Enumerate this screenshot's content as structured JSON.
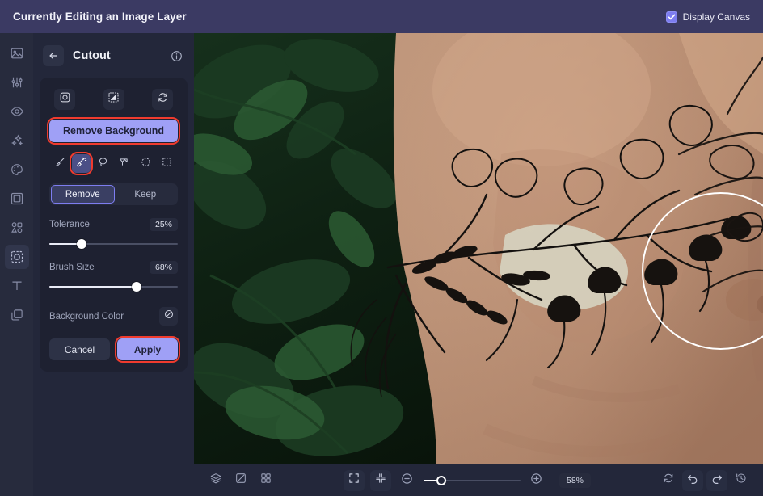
{
  "topbar": {
    "title": "Currently Editing an Image Layer",
    "display_canvas_label": "Display Canvas",
    "display_canvas_checked": true,
    "bg_color": "#3b3a63"
  },
  "sidebar": {
    "items": [
      {
        "name": "image",
        "label": "Image"
      },
      {
        "name": "adjust",
        "label": "Adjust"
      },
      {
        "name": "retouch",
        "label": "Retouch"
      },
      {
        "name": "effects",
        "label": "Effects"
      },
      {
        "name": "artistic",
        "label": "Artistic"
      },
      {
        "name": "frames",
        "label": "Frames"
      },
      {
        "name": "elements",
        "label": "Elements"
      },
      {
        "name": "cutout",
        "label": "Cutout"
      },
      {
        "name": "text",
        "label": "Text"
      },
      {
        "name": "layers",
        "label": "Layers"
      }
    ],
    "active_index": 7
  },
  "panel": {
    "title": "Cutout",
    "back_label": "Back",
    "info_label": "Info",
    "mask_tools": [
      {
        "name": "selection-mask",
        "label": "Selection Mask"
      },
      {
        "name": "invert-mask",
        "label": "Invert Mask"
      },
      {
        "name": "reset-mask",
        "label": "Reset Mask"
      }
    ],
    "remove_background_label": "Remove Background",
    "brush_tools": [
      {
        "name": "brush",
        "label": "Brush"
      },
      {
        "name": "magic-wand",
        "label": "Magic Wand"
      },
      {
        "name": "lasso",
        "label": "Lasso"
      },
      {
        "name": "polygon-lasso",
        "label": "Polygon Lasso"
      },
      {
        "name": "ellipse-select",
        "label": "Ellipse Select"
      },
      {
        "name": "rectangle-select",
        "label": "Rectangle Select"
      }
    ],
    "brush_tool_selected": 1,
    "mode": {
      "remove_label": "Remove",
      "keep_label": "Keep",
      "selected": "Remove"
    },
    "tolerance": {
      "label": "Tolerance",
      "value": "25%",
      "percent": 25
    },
    "brush_size": {
      "label": "Brush Size",
      "value": "68%",
      "percent": 68
    },
    "background_color": {
      "label": "Background Color",
      "value": "none"
    },
    "cancel_label": "Cancel",
    "apply_label": "Apply",
    "accent": "#9fa0f6",
    "highlight_outline": "#f03b2e"
  },
  "bottombar": {
    "left_tools": [
      {
        "name": "layers-stack",
        "label": "Layers"
      },
      {
        "name": "transform",
        "label": "Transform"
      },
      {
        "name": "grid",
        "label": "Grid"
      }
    ],
    "view_tools": [
      {
        "name": "fit-to-screen",
        "label": "Fit to Screen"
      },
      {
        "name": "actual-size",
        "label": "Actual Size"
      }
    ],
    "zoom_out_label": "Zoom Out",
    "zoom_in_label": "Zoom In",
    "zoom_value": "58%",
    "zoom_percent": 58,
    "right_tools": [
      {
        "name": "reset",
        "label": "Reset"
      },
      {
        "name": "undo",
        "label": "Undo"
      },
      {
        "name": "redo",
        "label": "Redo"
      },
      {
        "name": "history",
        "label": "History"
      }
    ]
  },
  "canvas": {
    "description": "Photo of a man's torso with floral line-art tattoos against dark green foliage",
    "brush_cursor_label": "Brush Cursor"
  }
}
